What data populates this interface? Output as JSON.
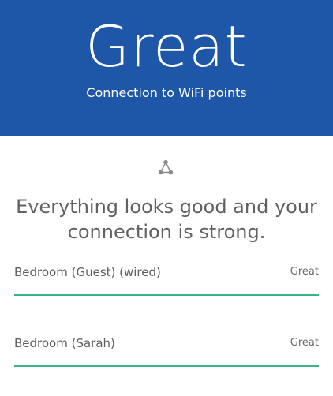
{
  "header": {
    "title": "Great",
    "subtitle": "Connection to WiFi points"
  },
  "status": {
    "icon": "mesh-network-icon",
    "message_line1": "Everything looks good and your",
    "message_line2": "connection is strong."
  },
  "points": [
    {
      "name": "Bedroom (Guest) (wired)",
      "quality": "Great"
    },
    {
      "name": "Bedroom (Sarah)",
      "quality": "Great"
    }
  ],
  "colors": {
    "header_bg": "#1f57a8",
    "status_bar": "#39b38a"
  }
}
